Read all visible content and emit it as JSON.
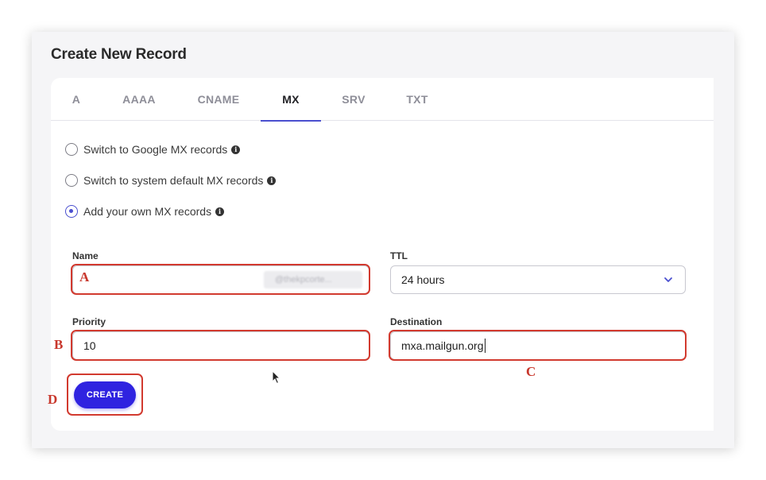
{
  "page": {
    "title": "Create New Record"
  },
  "tabs": [
    {
      "label": "A",
      "active": false
    },
    {
      "label": "AAAA",
      "active": false
    },
    {
      "label": "CNAME",
      "active": false
    },
    {
      "label": "MX",
      "active": true
    },
    {
      "label": "SRV",
      "active": false
    },
    {
      "label": "TXT",
      "active": false
    }
  ],
  "options": [
    {
      "label": "Switch to Google MX records",
      "checked": false
    },
    {
      "label": "Switch to system default MX records",
      "checked": false
    },
    {
      "label": "Add your own MX records",
      "checked": true
    }
  ],
  "form": {
    "name_label": "Name",
    "name_value": "",
    "name_suffix_blurred": "@thekpcorte...",
    "ttl_label": "TTL",
    "ttl_value": "24 hours",
    "priority_label": "Priority",
    "priority_value": "10",
    "destination_label": "Destination",
    "destination_value": "mxa.mailgun.org",
    "create_label": "CREATE"
  },
  "annotations": {
    "a": "A",
    "b": "B",
    "c": "C",
    "d": "D"
  },
  "colors": {
    "accent": "#4a4fcf",
    "button": "#2f23e0",
    "annotation": "#d23a2f"
  },
  "icons": {
    "info": "info-icon",
    "chevron": "chevron-down-icon",
    "cursor": "mouse-pointer-icon"
  }
}
